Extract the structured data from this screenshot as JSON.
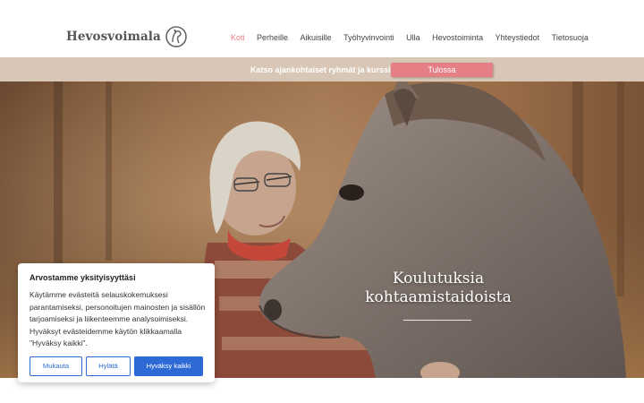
{
  "header": {
    "logo_text": "Hevosvoimala",
    "logo_icon": "horse-head-icon",
    "nav": [
      {
        "label": "Koti",
        "active": true
      },
      {
        "label": "Perheille"
      },
      {
        "label": "Aikuisille"
      },
      {
        "label": "Työhyvinvointi"
      },
      {
        "label": "Ulla"
      },
      {
        "label": "Hevostoiminta"
      },
      {
        "label": "Yhteystiedot"
      },
      {
        "label": "Tietosuoja"
      }
    ]
  },
  "banner": {
    "text": "Katso ajankohtaiset ryhmät ja kurssit:",
    "button": "Tulossa"
  },
  "hero": {
    "title_line1": "Koulutuksia",
    "title_line2": "kohtaamistaidoista"
  },
  "cookie": {
    "title": "Arvostamme yksityisyyttäsi",
    "body": "Käytämme evästeitä selauskokemuksesi parantamiseksi, personoitujen mainosten ja sisällön tarjoamiseksi ja liikenteemme analysoimiseksi. Hyväksyt evästeidemme käytön klikkaamalla \"Hyväksy kaikki\".",
    "customize": "Mukauta",
    "reject": "Hylätä",
    "accept": "Hyväksy kaikki"
  },
  "colors": {
    "accent": "#e57f86",
    "banner": "#d8c7b6",
    "button_blue": "#2e6ad6"
  }
}
